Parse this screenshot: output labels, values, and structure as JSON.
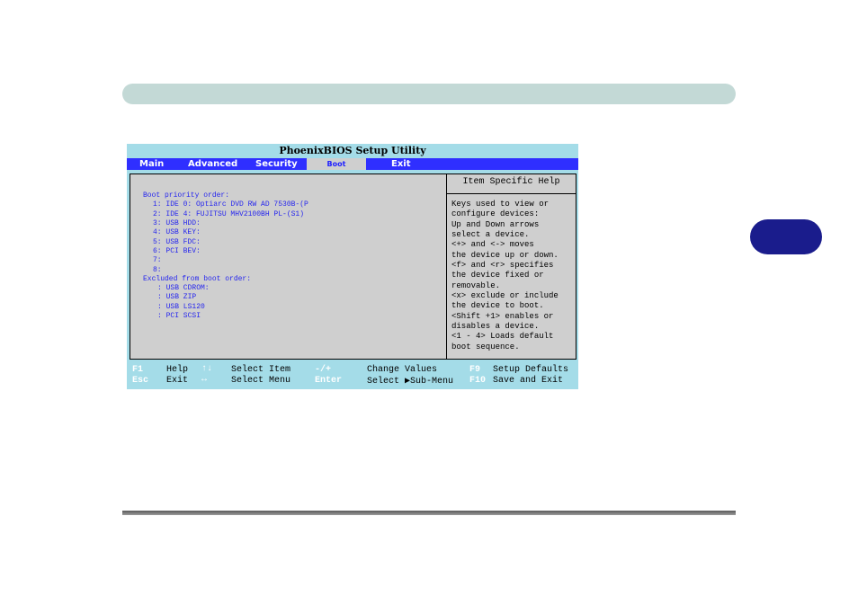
{
  "bios": {
    "title": "PhoenixBIOS Setup Utility",
    "menu": [
      "Main",
      "Advanced",
      "Security",
      "Boot",
      "Exit"
    ],
    "active_menu": "Boot",
    "boot_priority": {
      "heading": "Boot priority order:",
      "items": [
        "1:  IDE 0: Optiarc DVD RW AD 7530B-(P",
        "2:  IDE 4: FUJITSU MHV2100BH PL-(S1)",
        "3:  USB HDD:",
        "4:  USB KEY:",
        "5:  USB FDC:",
        "6:  PCI BEV:",
        "7:",
        "8:"
      ]
    },
    "excluded": {
      "heading": "Excluded from boot order:",
      "items": [
        ":  USB CDROM:",
        ":  USB ZIP",
        ":  USB LS120",
        ":  PCI SCSI"
      ]
    },
    "help": {
      "title": "Item Specific Help",
      "lines": [
        "Keys used to view or",
        "configure devices:",
        "Up and Down arrows",
        "select a device.",
        "<+> and <-> moves",
        "the device up or down.",
        "<f> and <r> specifies",
        "the device fixed or",
        "removable.",
        "<x> exclude or include",
        "the device to boot.",
        "<Shift +1> enables or",
        "disables a device.",
        "<1 - 4> Loads default",
        "boot sequence."
      ]
    },
    "footer": {
      "row1": {
        "k1": "F1",
        "d1": "Help",
        "arrows1": "↑↓",
        "d2": "Select Item",
        "k2": "-/+",
        "d3": "Change Values",
        "k3": "F9",
        "d4": "Setup Defaults"
      },
      "row2": {
        "k1": "Esc",
        "d1": "Exit",
        "arrows1": "↔",
        "d2": "Select Menu",
        "k2": "Enter",
        "d3": "Select ▶Sub-Menu",
        "k3": "F10",
        "d4": "Save and Exit"
      }
    }
  }
}
